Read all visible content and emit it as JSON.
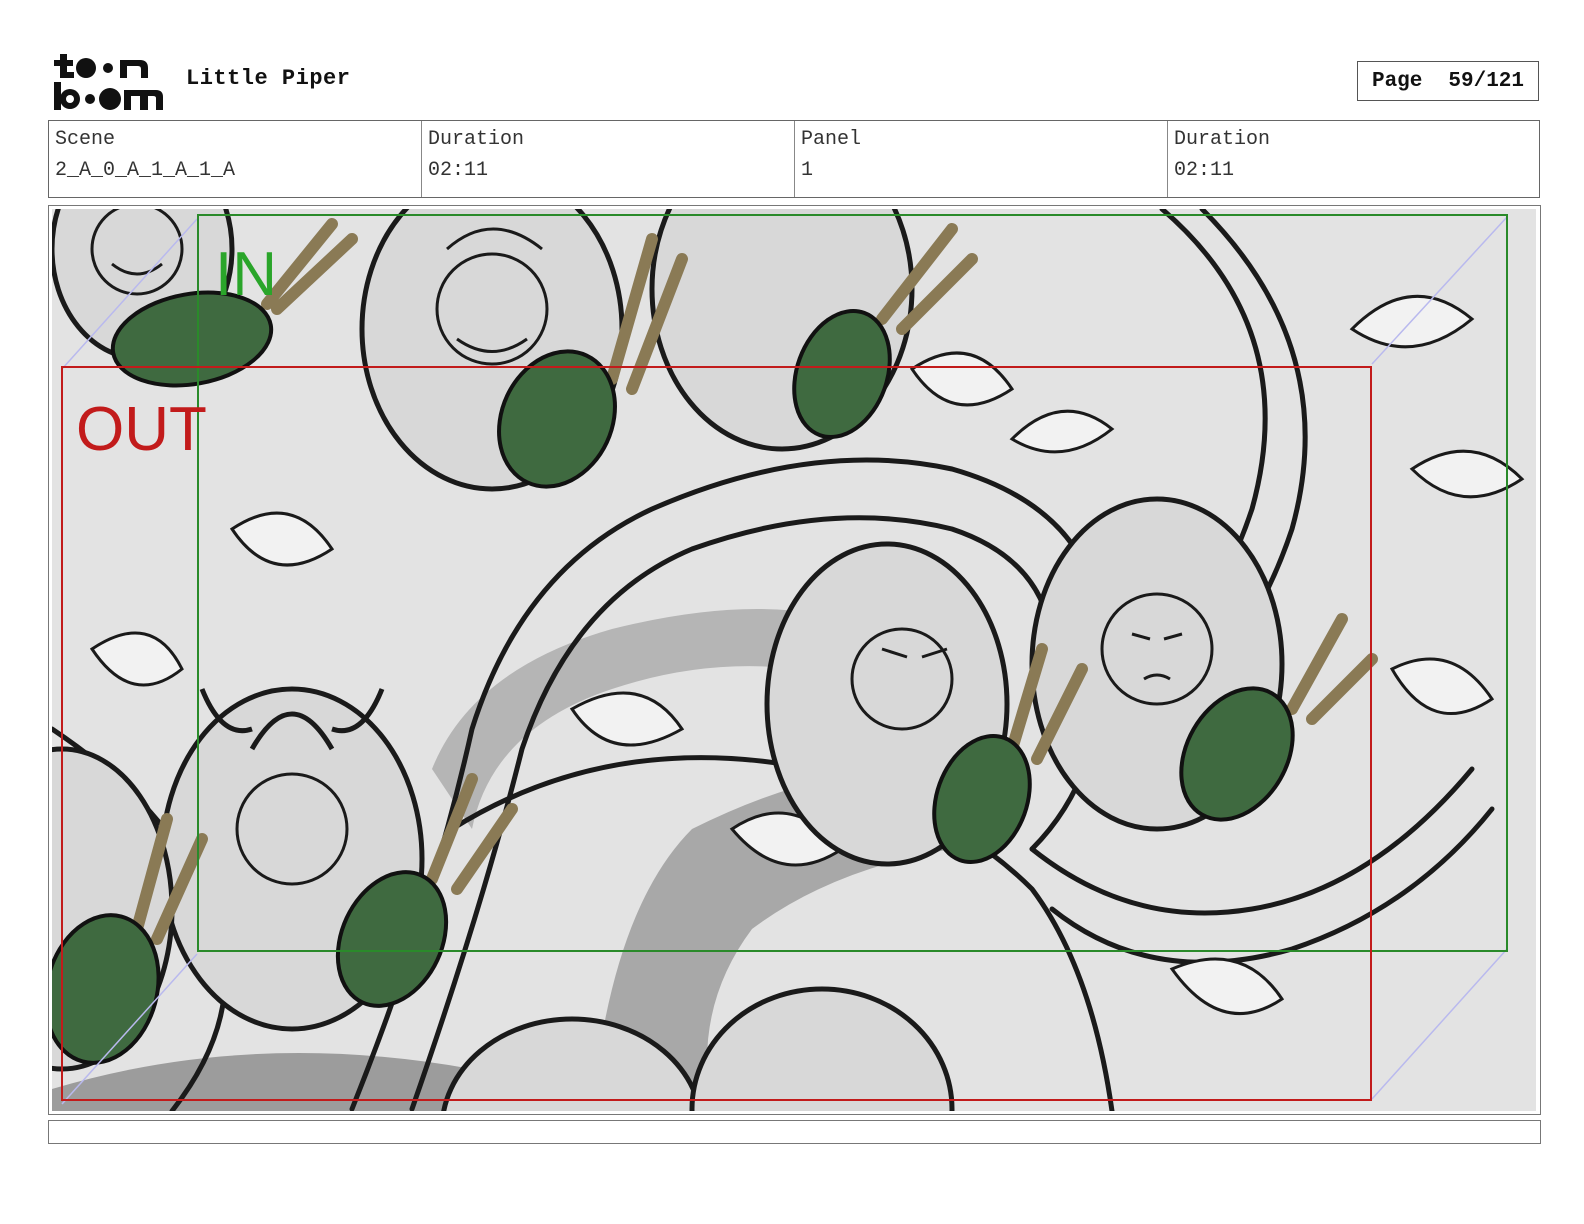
{
  "header": {
    "logo_text": "toonboom",
    "project_title": "Little Piper",
    "page_label": "Page",
    "page_number": "59/121"
  },
  "info": {
    "scene_label": "Scene",
    "scene_value": "2_A_0_A_1_A_1_A",
    "duration_label": "Duration",
    "duration_value": "02:11",
    "panel_label": "Panel",
    "panel_value": "1",
    "panel_duration_label": "Duration",
    "panel_duration_value": "02:11"
  },
  "panel": {
    "in_label": "IN",
    "out_label": "OUT",
    "colors": {
      "in_frame": "#2a8a2a",
      "out_frame": "#c21b1b",
      "leaf_green": "#3f6a40",
      "leaf_tan": "#8a7a55",
      "art_background": "#e3e3e3",
      "art_shadow": "#a8a8a8",
      "guide_lines": "#b9b9ee"
    }
  },
  "caption": {
    "text": ""
  }
}
